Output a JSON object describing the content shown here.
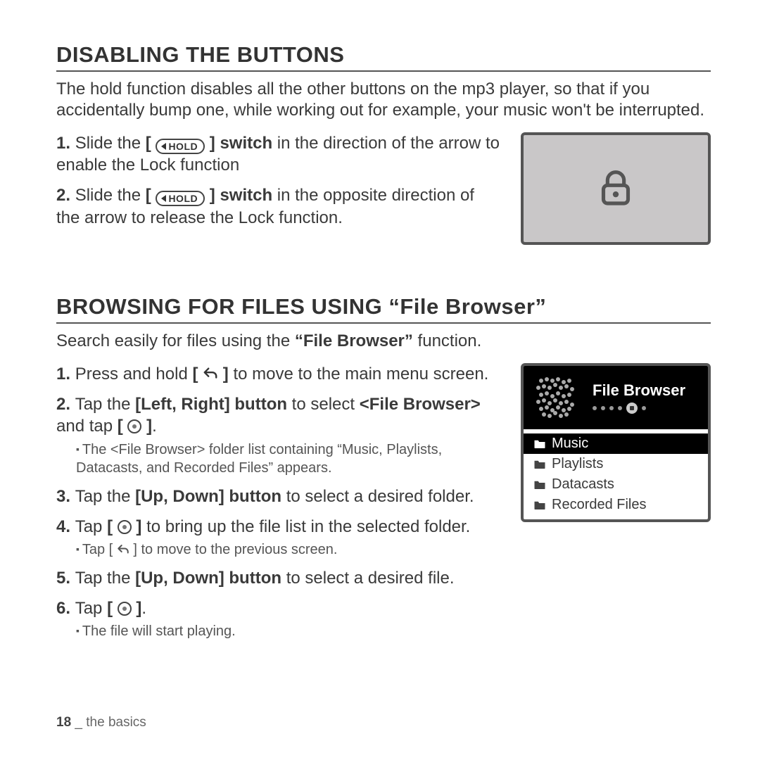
{
  "section1": {
    "heading": "DISABLING THE BUTTONS",
    "intro": "The hold function disables all the other buttons on the mp3 player, so that if you accidentally bump one, while working out for example, your music won't be interrupted.",
    "hold_label": "HOLD",
    "step1_a": "Slide the",
    "step1_b": "switch",
    "step1_c": " in the direction of the arrow to enable the Lock function",
    "step2_a": "Slide the",
    "step2_b": "switch",
    "step2_c": " in the opposite direction of the arrow to release the Lock function."
  },
  "section2": {
    "heading": "BROWSING FOR FILES USING “File Browser”",
    "intro_a": "Search easily for files using the ",
    "intro_b": "“File Browser”",
    "intro_c": " function.",
    "step1_a": "Press and hold ",
    "step1_b": " to move to the main menu screen.",
    "step2_a": "Tap the ",
    "step2_b": "[Left, Right] button",
    "step2_c": " to select ",
    "step2_d": "<File Browser>",
    "step2_e": " and tap ",
    "step2_sub": "The <File Browser> folder list containing “Music, Playlists, Datacasts, and Recorded Files” appears.",
    "step3_a": "Tap the ",
    "step3_b": "[Up, Down] button",
    "step3_c": " to select a desired folder.",
    "step4_a": "Tap ",
    "step4_b": " to bring up the file list in the selected folder.",
    "step4_sub_a": "Tap [ ",
    "step4_sub_b": " ] to move to the previous screen.",
    "step5_a": "Tap the ",
    "step5_b": "[Up, Down] button",
    "step5_c": " to select a desired file.",
    "step6_a": "Tap ",
    "step6_sub": "The file will start playing."
  },
  "device": {
    "title": "File Browser",
    "items": [
      "Music",
      "Playlists",
      "Datacasts",
      "Recorded Files"
    ],
    "selected_index": 0
  },
  "footer": {
    "page": "18",
    "label": "the basics",
    "sep": " _ "
  }
}
